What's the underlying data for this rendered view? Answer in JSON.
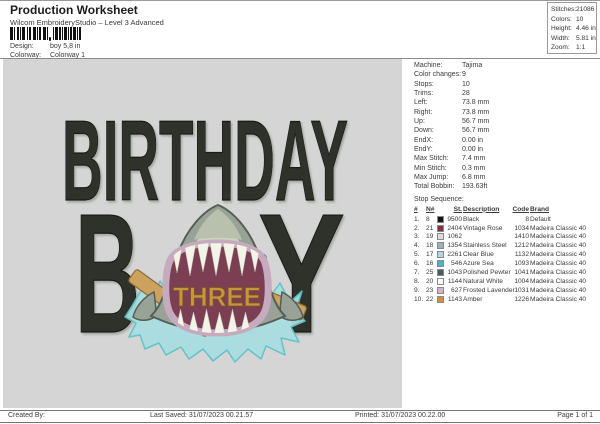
{
  "header": {
    "title": "Production Worksheet",
    "subtitle": "Wilcom EmbroideryStudio – Level 3 Advanced",
    "design_label": "Design:",
    "design_value": "boy 5,8 in",
    "colorway_label": "Colorway:",
    "colorway_value": "Colorway 1"
  },
  "stats_box": {
    "rows": [
      {
        "label": "Stitches:",
        "value": "21086"
      },
      {
        "label": "Colors:",
        "value": "10"
      },
      {
        "label": "Height:",
        "value": "4.46 in"
      },
      {
        "label": "Width:",
        "value": "5.81 in"
      },
      {
        "label": "Zoom:",
        "value": "1:1"
      }
    ]
  },
  "machine_info": {
    "rows": [
      {
        "label": "Machine:",
        "value": "Tajima"
      },
      {
        "label": "Color changes:",
        "value": "9"
      },
      {
        "label": "Stops:",
        "value": "10"
      },
      {
        "label": "Trims:",
        "value": "28"
      },
      {
        "label": "Left:",
        "value": "73.8 mm"
      },
      {
        "label": "Right:",
        "value": "73.8 mm"
      },
      {
        "label": "Up:",
        "value": "56.7 mm"
      },
      {
        "label": "Down:",
        "value": "56.7 mm"
      },
      {
        "label": "EndX:",
        "value": "0.00 in"
      },
      {
        "label": "EndY:",
        "value": "0.00 in"
      },
      {
        "label": "Max Stitch:",
        "value": "7.4 mm"
      },
      {
        "label": "Min Stitch:",
        "value": "0.3 mm"
      },
      {
        "label": "Max Jump:",
        "value": "6.8 mm"
      },
      {
        "label": "Total Bobbin:",
        "value": "193.63ft"
      }
    ]
  },
  "stop_sequence": {
    "title": "Stop Sequence:",
    "columns": {
      "num": "#",
      "n": "N#",
      "st": "St.",
      "description": "Description",
      "code": "Code",
      "brand": "Brand"
    },
    "rows": [
      {
        "num": "1.",
        "n": "8",
        "swatch": "#151515",
        "st": "9500",
        "description": "Black",
        "code": "8",
        "brand": "Default"
      },
      {
        "num": "2.",
        "n": "21",
        "swatch": "#8b2e40",
        "st": "2404",
        "description": "Vintage Rose",
        "code": "1034",
        "brand": "Madeira Classic 40"
      },
      {
        "num": "3.",
        "n": "19",
        "swatch": "#dcdcdc",
        "st": "1062",
        "description": "",
        "code": "1410",
        "brand": "Madeira Classic 40"
      },
      {
        "num": "4.",
        "n": "18",
        "swatch": "#9db1bd",
        "st": "1354",
        "description": "Stainless Steel",
        "code": "1212",
        "brand": "Madeira Classic 40"
      },
      {
        "num": "5.",
        "n": "17",
        "swatch": "#b9d3e2",
        "st": "2261",
        "description": "Clear Blue",
        "code": "1132",
        "brand": "Madeira Classic 40"
      },
      {
        "num": "6.",
        "n": "16",
        "swatch": "#45b5c9",
        "st": "546",
        "description": "Azure Sea",
        "code": "1093",
        "brand": "Madeira Classic 40"
      },
      {
        "num": "7.",
        "n": "25",
        "swatch": "#4d575d",
        "st": "1043",
        "description": "Polished Pewter",
        "code": "1041",
        "brand": "Madeira Classic 40"
      },
      {
        "num": "8.",
        "n": "20",
        "swatch": "#fbfbf9",
        "st": "1144",
        "description": "Natural White",
        "code": "1004",
        "brand": "Madeira Classic 40"
      },
      {
        "num": "9.",
        "n": "23",
        "swatch": "#d2b3c9",
        "st": "627",
        "description": "Frosted Lavender",
        "code": "1031",
        "brand": "Madeira Classic 40"
      },
      {
        "num": "10.",
        "n": "22",
        "swatch": "#d68c3e",
        "st": "1143",
        "description": "Amber",
        "code": "1226",
        "brand": "Madeira Classic 40"
      }
    ]
  },
  "design": {
    "line1": "BIRTHDAY",
    "boy_left": "B",
    "boy_right": "Y",
    "banner_text": "THREE",
    "colors": {
      "canvas-bg": "#d5d5d5",
      "letters": "#2d322b",
      "letters-edge": "#171b14",
      "shark-body": "#98a297",
      "shark-edge": "#565f56",
      "shark-face": "#cdd2bf",
      "shark-snout": "#b9c0ad",
      "mouth": "#7c3e52",
      "gums": "#c6aabe",
      "teeth": "#f3f3ea",
      "banner-text": "#c7953d",
      "banner-edge": "#7a591f",
      "water": "#a9dde1",
      "water-edge": "#5ec1c9",
      "oar": "#cda25f",
      "oar-edge": "#8e6d38",
      "eye": "#4c554e"
    }
  },
  "footer": {
    "created_by": "Created By:",
    "last_saved": "Last Saved: 31/07/2023 00.21.57",
    "printed": "Printed: 31/07/2023 00.22.00",
    "page": "Page 1 of 1"
  }
}
